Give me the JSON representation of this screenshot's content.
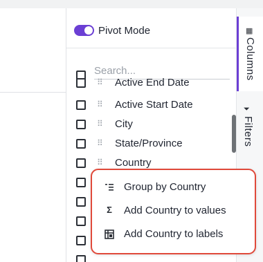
{
  "pivot": {
    "label": "Pivot Mode",
    "enabled": true,
    "accent_color": "#6b3fd4"
  },
  "search": {
    "placeholder": "Search..."
  },
  "columns": [
    {
      "label": "Active End Date",
      "icon": "drag-handle-icon"
    },
    {
      "label": "Active Start Date",
      "icon": "drag-handle-icon"
    },
    {
      "label": "City",
      "icon": "drag-handle-icon"
    },
    {
      "label": "State/Province",
      "icon": "drag-handle-icon"
    },
    {
      "label": "Country",
      "icon": "drag-handle-icon"
    }
  ],
  "sidebar": {
    "tabs": [
      {
        "label": "Columns",
        "icon": "columns-grid-icon",
        "active": true
      },
      {
        "label": "Filters",
        "icon": "filter-icon",
        "active": false
      }
    ]
  },
  "context_menu": {
    "border_color": "#e0493a",
    "items": [
      {
        "label": "Group by Country",
        "icon": "group-rows-icon"
      },
      {
        "label": "Add Country to values",
        "icon": "sigma-icon"
      },
      {
        "label": "Add Country to labels",
        "icon": "pivot-table-icon"
      }
    ]
  }
}
